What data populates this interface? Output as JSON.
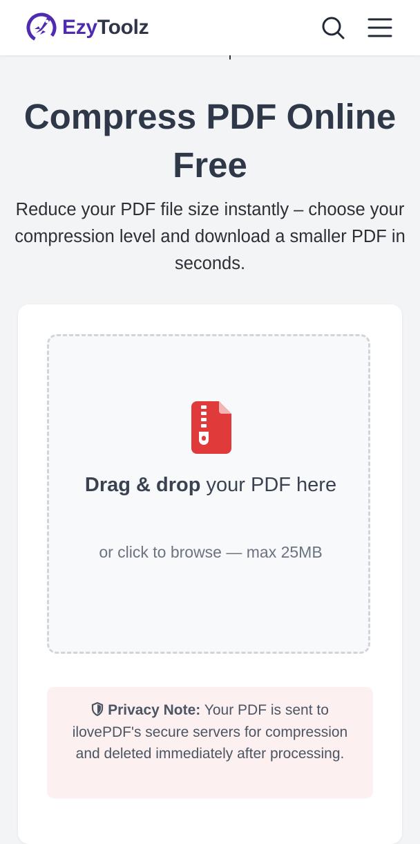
{
  "header": {
    "brand_prefix": "Ezy",
    "brand_suffix": "Toolz",
    "icons": {
      "logo": "rocket-logo-icon",
      "search": "search-icon",
      "menu": "hamburger-menu-icon"
    }
  },
  "hero": {
    "title": "Compress PDF Online Free",
    "subtitle": "Reduce your PDF file size instantly – choose your compression level and download a smaller PDF in seconds."
  },
  "upload": {
    "icon": "zip-file-icon",
    "title_bold": "Drag & drop",
    "title_rest": " your PDF here",
    "hint": "or click to browse — max 25MB"
  },
  "privacy": {
    "icon": "shield-icon",
    "label": "Privacy Note:",
    "text": " Your PDF is sent to ilovePDF's secure servers for compression and deleted immediately after processing."
  },
  "colors": {
    "brand_purple": "#4f2bb0",
    "file_icon_red": "#e03a3a",
    "privacy_bg": "#fdf0f0",
    "page_bg": "#f3f4f6"
  }
}
